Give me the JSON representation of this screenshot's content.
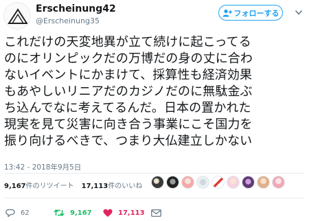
{
  "user": {
    "display_name": "Erscheinung42",
    "handle": "@Erscheinung35"
  },
  "follow_button": {
    "label": "フォローする"
  },
  "tweet": {
    "lines": [
      "これだけの天変地異が立て続けに起こってる",
      "のにオリンピックだの万博だの身の丈に合わ",
      "ないイベントにかまけて、採算性も経済効果",
      "もあやしいリニアだのカジノだのに無駄金ぶ",
      "ち込んでなに考えてるんだ。日本の置かれた",
      "現実を見て災害に向き合う事業にこそ国力を",
      "振り向けるべきで、つまり大仏建立しかない"
    ],
    "timestamp": "13:42 - 2018年9月5日"
  },
  "stats": {
    "retweets_count": "9,167",
    "retweets_label": "件のリツイート",
    "likes_count": "17,113",
    "likes_label": "件のいいね"
  },
  "actions": {
    "reply_count": "62",
    "retweet_count": "9,167",
    "like_count": "17,113"
  },
  "colors": {
    "accent": "#1da1f2",
    "retweet": "#17bf63",
    "like": "#e0245e",
    "muted": "#657786"
  },
  "icons": {
    "follow": "add-user-icon",
    "caret": "chevron-down-icon",
    "reply": "reply-icon",
    "retweet": "retweet-icon",
    "like": "heart-icon",
    "dm": "envelope-icon"
  }
}
